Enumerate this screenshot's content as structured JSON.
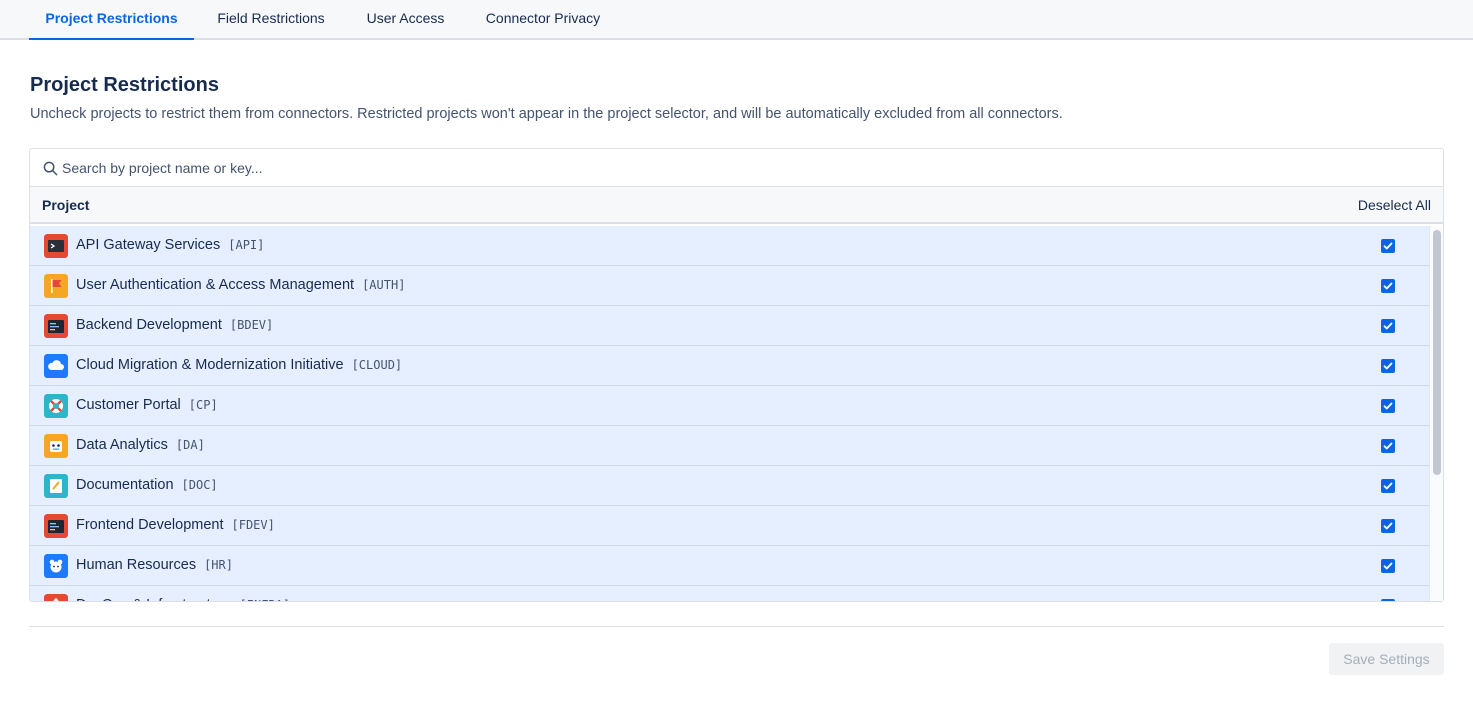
{
  "tabs": [
    {
      "label": "Project Restrictions",
      "active": true
    },
    {
      "label": "Field Restrictions",
      "active": false
    },
    {
      "label": "User Access",
      "active": false
    },
    {
      "label": "Connector Privacy",
      "active": false
    }
  ],
  "page": {
    "title": "Project Restrictions",
    "description": "Uncheck projects to restrict them from connectors. Restricted projects won't appear in the project selector, and will be automatically excluded from all connectors."
  },
  "search": {
    "placeholder": "Search by project name or key..."
  },
  "table": {
    "column_header": "Project",
    "deselect_label": "Deselect All",
    "rows": [
      {
        "name": "API Gateway Services",
        "key": "[API]",
        "icon": "terminal-icon",
        "color": "#e34935",
        "checked": true
      },
      {
        "name": "User Authentication & Access Management",
        "key": "[AUTH]",
        "icon": "flag-icon",
        "color": "#f5a623",
        "checked": true
      },
      {
        "name": "Backend Development",
        "key": "[BDEV]",
        "icon": "code-window-icon",
        "color": "#e34935",
        "checked": true
      },
      {
        "name": "Cloud Migration & Modernization Initiative",
        "key": "[CLOUD]",
        "icon": "cloud-icon",
        "color": "#1d7afc",
        "checked": true
      },
      {
        "name": "Customer Portal",
        "key": "[CP]",
        "icon": "lifebuoy-icon",
        "color": "#2fb5c9",
        "checked": true
      },
      {
        "name": "Data Analytics",
        "key": "[DA]",
        "icon": "robot-icon",
        "color": "#f5a623",
        "checked": true
      },
      {
        "name": "Documentation",
        "key": "[DOC]",
        "icon": "notepad-icon",
        "color": "#2fb5c9",
        "checked": true
      },
      {
        "name": "Frontend Development",
        "key": "[FDEV]",
        "icon": "code-window-icon",
        "color": "#e34935",
        "checked": true
      },
      {
        "name": "Human Resources",
        "key": "[HR]",
        "icon": "bear-icon",
        "color": "#1d7afc",
        "checked": true
      },
      {
        "name": "DevOps & Infrastructure",
        "key": "[INFRA]",
        "icon": "rocket-icon",
        "color": "#e34935",
        "checked": true
      }
    ]
  },
  "footer": {
    "save_label": "Save Settings"
  },
  "colors": {
    "accent": "#0c66e4",
    "row_selected": "#e6efff"
  }
}
